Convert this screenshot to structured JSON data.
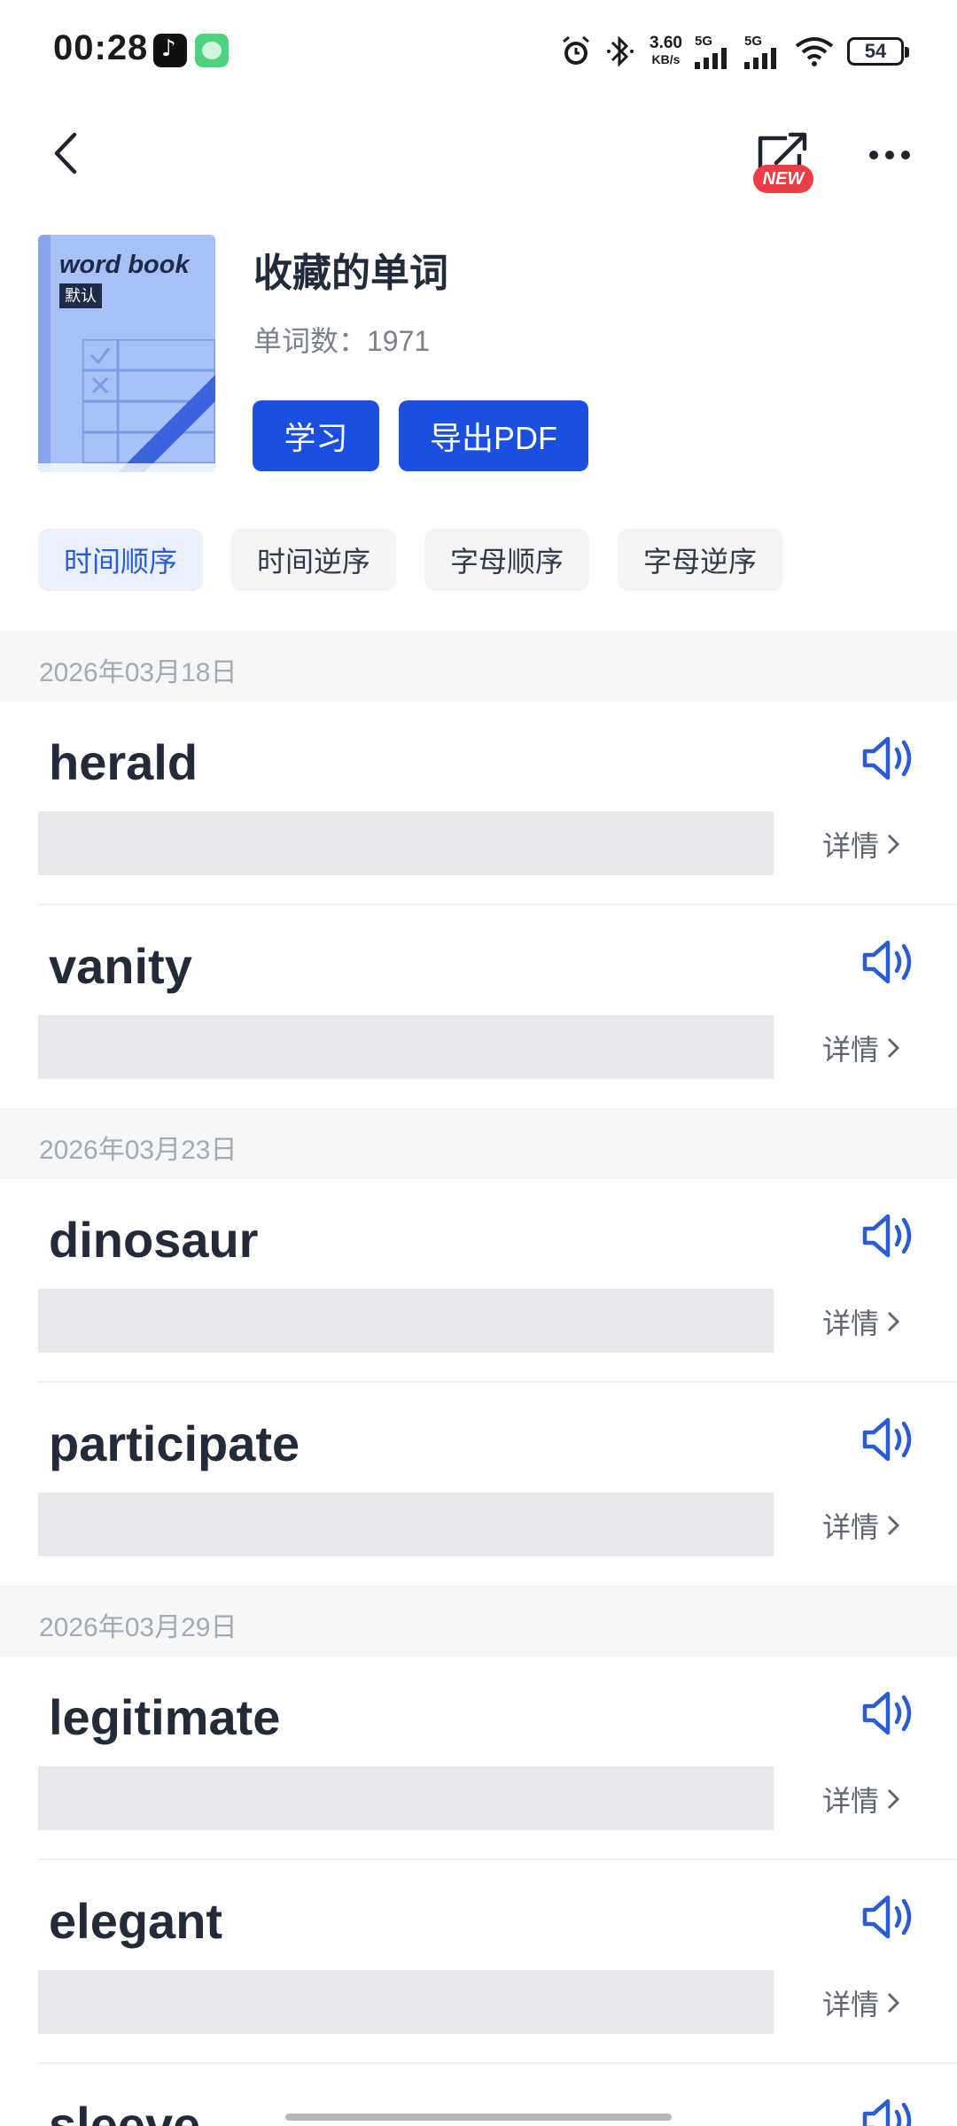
{
  "status_bar": {
    "time": "00:28",
    "net_speed": "3.60",
    "net_unit": "KB/s",
    "signal_1": "5G",
    "signal_2": "5G",
    "battery": "54"
  },
  "nav": {
    "new_badge": "NEW"
  },
  "book": {
    "cover_title": "word book",
    "cover_tag": "默认",
    "title": "收藏的单词",
    "word_count": "单词数：1971",
    "study_button": "学习",
    "export_button": "导出PDF"
  },
  "sort_options": [
    "时间顺序",
    "时间逆序",
    "字母顺序",
    "字母逆序"
  ],
  "detail_label": "详情",
  "groups": [
    {
      "date": "2026年03月18日",
      "words": [
        "herald",
        "vanity"
      ]
    },
    {
      "date": "2026年03月23日",
      "words": [
        "dinosaur",
        "participate"
      ]
    },
    {
      "date": "2026年03月29日",
      "words": [
        "legitimate",
        "elegant",
        "sleeve"
      ]
    }
  ],
  "colors": {
    "accent": "#1a4fe0",
    "speaker": "#2a5bd7",
    "badge": "#ee3d45"
  }
}
